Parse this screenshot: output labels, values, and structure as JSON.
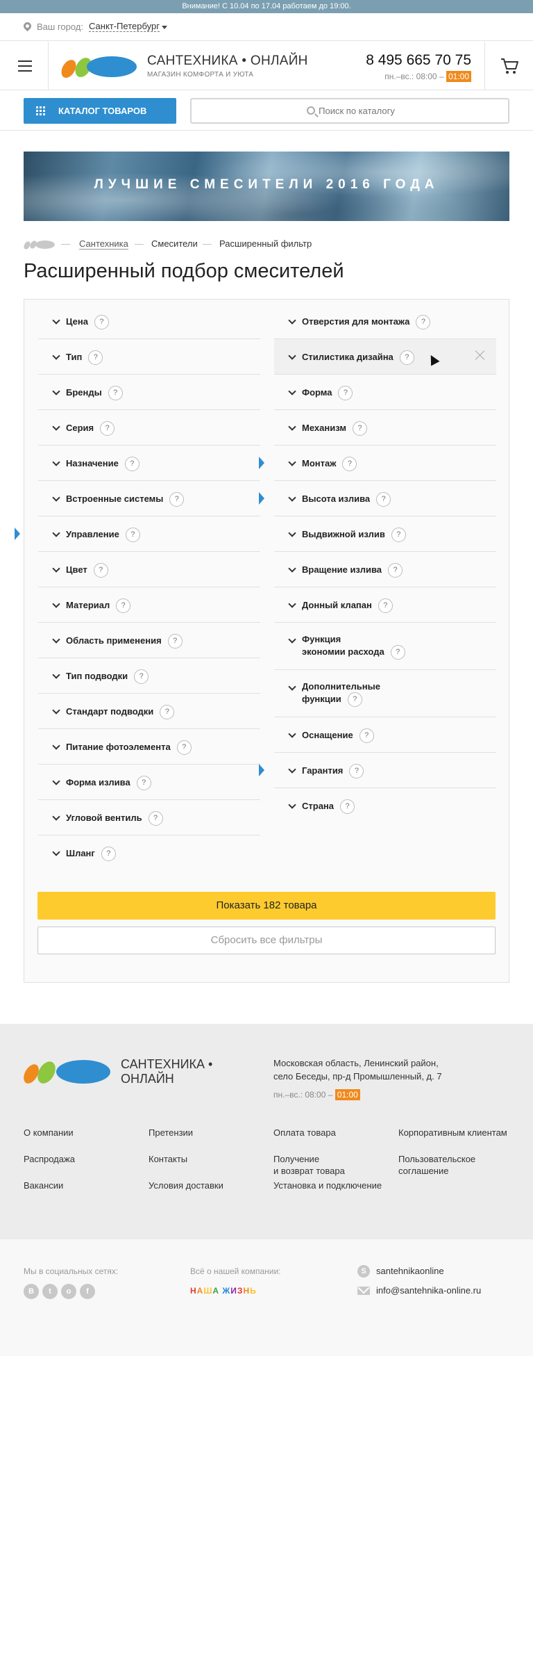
{
  "notice": "Внимание! С 10.04 по 17.04 работаем до 19:00.",
  "city": {
    "label": "Ваш город:",
    "value": "Санкт-Петербург"
  },
  "header": {
    "logo_title": "САНТЕХНИКА • ОНЛАЙН",
    "logo_subtitle": "МАГАЗИН КОМФОРТА И УЮТА",
    "phone": "8 495 665 70 75",
    "hours_prefix": "пн.–вс.: 08:00 –",
    "hours_end": "01:00"
  },
  "search": {
    "catalog_label": "КАТАЛОГ ТОВАРОВ",
    "placeholder": "Поиск по каталогу"
  },
  "banner": {
    "text": "ЛУЧШИЕ СМЕСИТЕЛИ 2016 ГОДА"
  },
  "breadcrumb": [
    "Сантехника",
    "Смесители",
    "Расширенный фильтр"
  ],
  "page_title": "Расширенный подбор смесителей",
  "filters_left": [
    {
      "label": "Цена",
      "help": "?"
    },
    {
      "label": "Тип",
      "help": "?"
    },
    {
      "label": "Бренды",
      "help": "?"
    },
    {
      "label": "Серия",
      "help": "?"
    },
    {
      "label": "Назначение",
      "help": "?"
    },
    {
      "label": "Встроенные системы",
      "help": "?"
    },
    {
      "label": "Управление",
      "help": "?",
      "active": true
    },
    {
      "label": "Цвет",
      "help": "?"
    },
    {
      "label": "Материал",
      "help": "?"
    },
    {
      "label": "Область применения",
      "help": "?"
    },
    {
      "label": "Тип подводки",
      "help": "?"
    },
    {
      "label": "Стандарт подводки",
      "help": "?"
    },
    {
      "label": "Питание фотоэлемента",
      "help": "?"
    },
    {
      "label": "Форма излива",
      "help": "?"
    },
    {
      "label": "Угловой вентиль",
      "help": "?"
    },
    {
      "label": "Шланг",
      "help": "?"
    }
  ],
  "filters_right": [
    {
      "label": "Отверстия для монтажа",
      "help": "?"
    },
    {
      "label": "Стилистика дизайна",
      "help": "?",
      "hover": true
    },
    {
      "label": "Форма",
      "help": "?"
    },
    {
      "label": "Механизм",
      "help": "?"
    },
    {
      "label": "Монтаж",
      "help": "?",
      "active": true
    },
    {
      "label": "Высота излива",
      "help": "?",
      "active": true
    },
    {
      "label": "Выдвижной излив",
      "help": "?"
    },
    {
      "label": "Вращение излива",
      "help": "?"
    },
    {
      "label": "Донный клапан",
      "help": "?"
    },
    {
      "label": "Функция\nэкономии расхода",
      "help": "?"
    },
    {
      "label": "Дополнительные\nфункции",
      "help": "?"
    },
    {
      "label": "Оснащение",
      "help": "?"
    },
    {
      "label": "Гарантия",
      "help": "?",
      "active": true
    },
    {
      "label": "Страна",
      "help": "?"
    }
  ],
  "actions": {
    "show": "Показать 182 товара",
    "reset": "Сбросить все фильтры"
  },
  "footer": {
    "logo_text_1": "САНТЕХНИКА •",
    "logo_text_2": "ОНЛАЙН",
    "address_1": "Московская область, Ленинский район,",
    "address_2": "село Беседы, пр-д Промышленный, д. 7",
    "hours_prefix": "пн.–вс.: 08:00 –",
    "hours_end": "01:00",
    "links": [
      "О компании",
      "Претензии",
      "Оплата товара",
      "Корпоративным клиентам",
      "Распродажа",
      "Контакты",
      "Получение\nи возврат товара",
      "Пользовательское\nсоглашение",
      "Вакансии",
      "Условия доставки",
      "Установка и подключение"
    ]
  },
  "bottom": {
    "social_label": "Мы в социальных сетях:",
    "social": [
      "В",
      "t",
      "о",
      "f"
    ],
    "company_label": "Всё о нашей компании:",
    "company_brand": "НАША ЖИЗНЬ",
    "skype": "santehnikaonline",
    "email": "info@santehnika-online.ru"
  },
  "colors": {
    "accent": "#2e8ed0",
    "button_yellow": "#fecb2f",
    "orange": "#f08a1d",
    "notice": "#7b9fb1"
  }
}
